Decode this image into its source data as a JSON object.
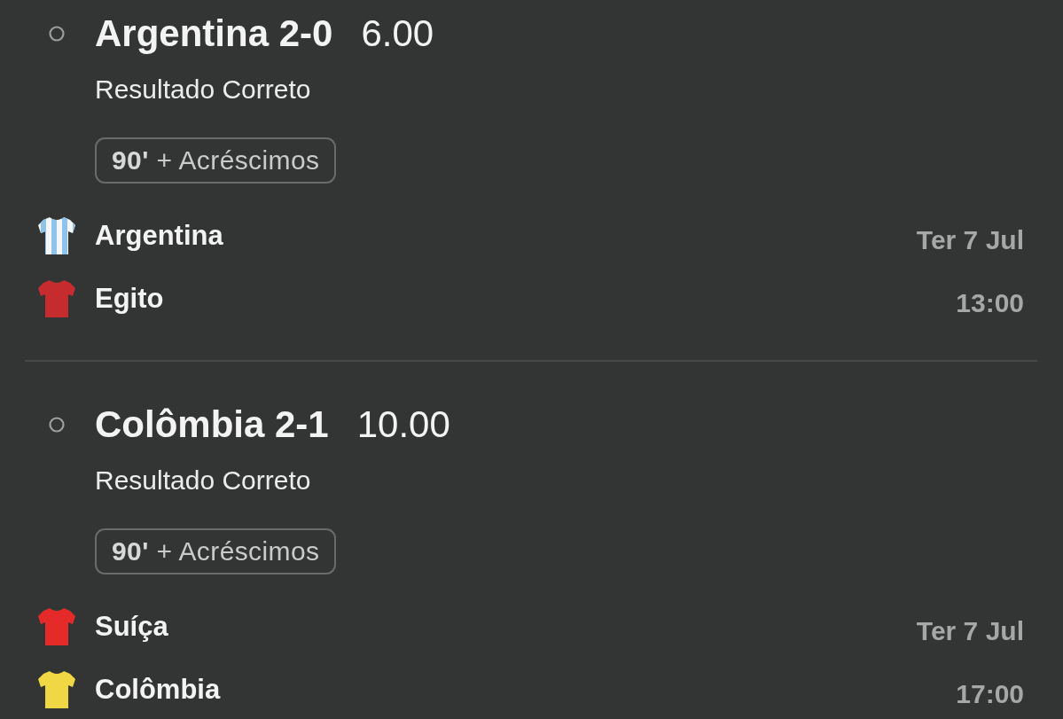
{
  "bets": [
    {
      "selected": false,
      "selection": "Argentina 2-0",
      "odds": "6.00",
      "market": "Resultado Correto",
      "period": "**90'** + Acréscimos",
      "teams": [
        {
          "name": "Argentina",
          "kind": "striped",
          "color": "#8fc3ea"
        },
        {
          "name": "Egito",
          "kind": "plain",
          "color": "#c62b2e"
        }
      ],
      "date": "Ter 7 Jul",
      "time": "13:00"
    },
    {
      "selected": false,
      "selection": "Colômbia 2-1",
      "odds": "10.00",
      "market": "Resultado Correto",
      "period": "**90'** + Acréscimos",
      "teams": [
        {
          "name": "Suíça",
          "kind": "plain",
          "color": "#e52a2a"
        },
        {
          "name": "Colômbia",
          "kind": "plain",
          "color": "#f0d845"
        }
      ],
      "date": "Ter 7 Jul",
      "time": "17:00"
    }
  ]
}
